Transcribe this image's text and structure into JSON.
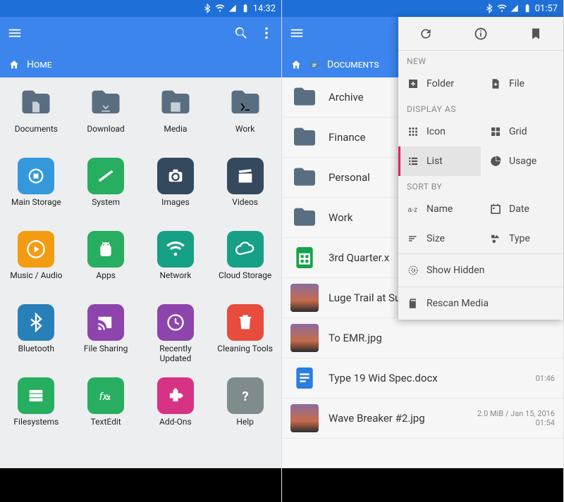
{
  "left": {
    "status": {
      "time": "14:32"
    },
    "crumb": "Home",
    "items": [
      {
        "label": "Documents",
        "kind": "folder",
        "inner": "doc"
      },
      {
        "label": "Download",
        "kind": "folder",
        "inner": "download"
      },
      {
        "label": "Media",
        "kind": "folder",
        "inner": "image"
      },
      {
        "label": "Work",
        "kind": "folder",
        "inner": "terminal"
      },
      {
        "label": "Main Storage",
        "color": "#3498db",
        "inner": "storage"
      },
      {
        "label": "System",
        "color": "#27ae60",
        "inner": "root"
      },
      {
        "label": "Images",
        "color": "#34495e",
        "inner": "camera"
      },
      {
        "label": "Videos",
        "color": "#34495e",
        "inner": "clapper"
      },
      {
        "label": "Music / Audio",
        "color": "#f39c12",
        "inner": "play"
      },
      {
        "label": "Apps",
        "color": "#27ae60",
        "inner": "android"
      },
      {
        "label": "Network",
        "color": "#16a085",
        "inner": "wifi"
      },
      {
        "label": "Cloud Storage",
        "color": "#16a085",
        "inner": "cloud"
      },
      {
        "label": "Bluetooth",
        "color": "#2980b9",
        "inner": "bt"
      },
      {
        "label": "File Sharing",
        "color": "#8e44ad",
        "inner": "cast"
      },
      {
        "label": "Recently Updated",
        "color": "#8e44ad",
        "inner": "clock"
      },
      {
        "label": "Cleaning Tools",
        "color": "#e74c3c",
        "inner": "trash"
      },
      {
        "label": "Filesystems",
        "color": "#27ae60",
        "inner": "disks"
      },
      {
        "label": "TextEdit",
        "color": "#27ae60",
        "inner": "fx"
      },
      {
        "label": "Add-Ons",
        "color": "#d63384",
        "inner": "puzzle"
      },
      {
        "label": "Help",
        "color": "#7f8c8d",
        "inner": "help"
      }
    ]
  },
  "right": {
    "status": {
      "time": "01:57"
    },
    "crumb": "Documents",
    "rows": [
      {
        "name": "Archive",
        "kind": "folder"
      },
      {
        "name": "Finance",
        "kind": "folder"
      },
      {
        "name": "Personal",
        "kind": "folder"
      },
      {
        "name": "Work",
        "kind": "folder"
      },
      {
        "name": "3rd Quarter.x",
        "kind": "sheet"
      },
      {
        "name": "Luge Trail at Sunset.jpg",
        "kind": "image"
      },
      {
        "name": "To EMR.jpg",
        "kind": "image"
      },
      {
        "name": "Type 19 Wid Spec.docx",
        "kind": "doc",
        "meta": "01:46"
      },
      {
        "name": "Wave Breaker #2.jpg",
        "kind": "image",
        "meta": "2.0 MiB / Jan 15, 2016\n01:54"
      }
    ],
    "popup": {
      "sections": {
        "new": {
          "label": "NEW",
          "folder": "Folder",
          "file": "File"
        },
        "display": {
          "label": "DISPLAY AS",
          "icon": "Icon",
          "grid": "Grid",
          "list": "List",
          "usage": "Usage"
        },
        "sort": {
          "label": "SORT BY",
          "name": "Name",
          "date": "Date",
          "size": "Size",
          "type": "Type"
        }
      },
      "show_hidden": "Show Hidden",
      "rescan": "Rescan Media"
    }
  }
}
